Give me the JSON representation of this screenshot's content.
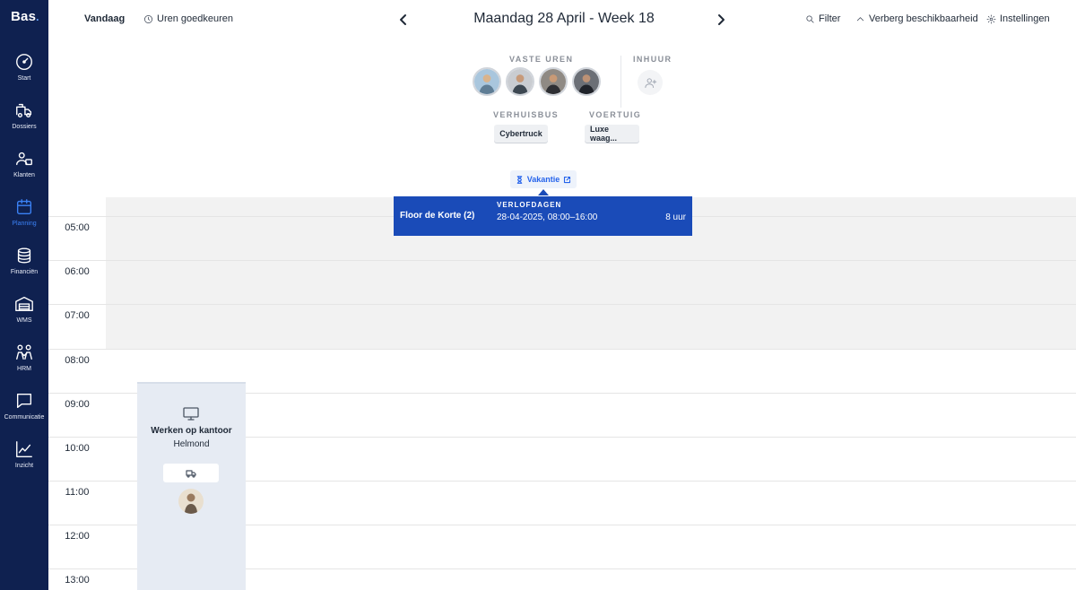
{
  "app": {
    "logo": "Bas",
    "logo_dot": "."
  },
  "sidebar": {
    "items": [
      {
        "label": "Start",
        "icon": "speedometer-icon"
      },
      {
        "label": "Dossiers",
        "icon": "moving-truck-icon"
      },
      {
        "label": "Klanten",
        "icon": "customers-icon"
      },
      {
        "label": "Planning",
        "icon": "calendar-icon",
        "active": true
      },
      {
        "label": "Financiën",
        "icon": "coins-icon"
      },
      {
        "label": "WMS",
        "icon": "warehouse-icon"
      },
      {
        "label": "HRM",
        "icon": "people-icon"
      },
      {
        "label": "Communicatie",
        "icon": "chat-icon"
      },
      {
        "label": "Inzicht",
        "icon": "chart-icon"
      }
    ]
  },
  "toolbar": {
    "today": "Vandaag",
    "approve_hours": "Uren goedkeuren",
    "date": "Maandag 28 April - Week 18",
    "filter": "Filter",
    "hide_availability": "Verberg beschikbaarheid",
    "settings": "Instellingen"
  },
  "resources": {
    "fixed_hours_label": "VASTE UREN",
    "hire_label": "INHUUR",
    "truck_label": "VERHUISBUS",
    "vehicle_label": "VOERTUIG",
    "truck_value": "Cybertruck",
    "vehicle_value": "Luxe waag...",
    "vacation_label": "Vakantie"
  },
  "calendar": {
    "hours": [
      "05:00",
      "06:00",
      "07:00",
      "08:00",
      "09:00",
      "10:00",
      "11:00",
      "12:00",
      "13:00"
    ]
  },
  "leave": {
    "name": "Floor de Korte (2)",
    "type": "VERLOFDAGEN",
    "time": "28-04-2025, 08:00–16:00",
    "hours": "8 uur"
  },
  "event": {
    "title": "Werken op kantoor",
    "location": "Helmond"
  },
  "colors": {
    "sidebar_bg": "#0f2150",
    "accent": "#1a4bb8",
    "active_nav": "#3b82f6"
  }
}
